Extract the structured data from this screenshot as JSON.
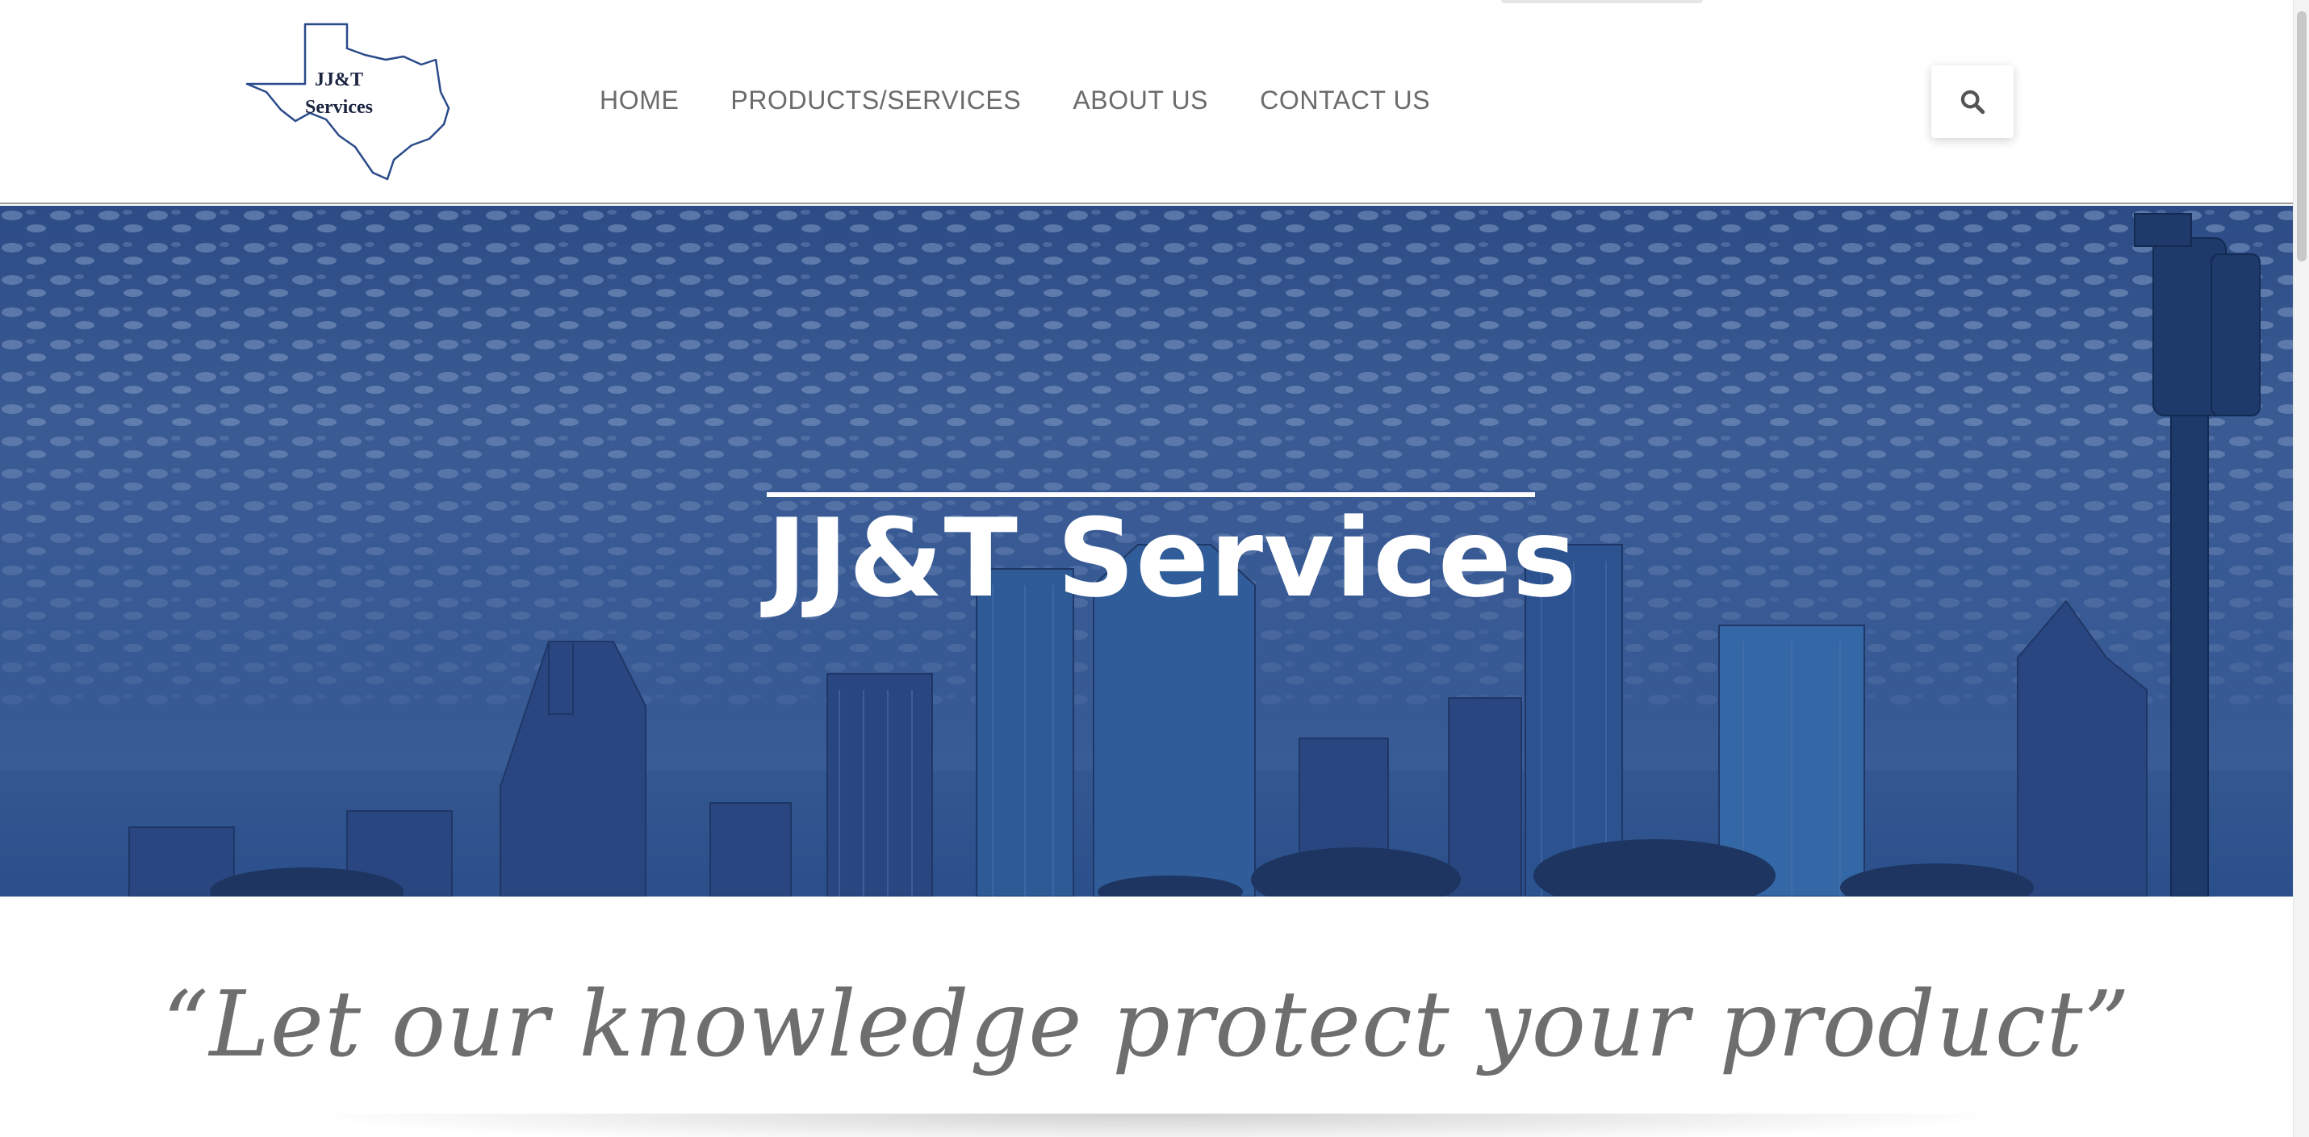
{
  "header": {
    "logo": {
      "line1": "JJ&T",
      "line2": "Services"
    },
    "nav": [
      {
        "label": "HOME"
      },
      {
        "label": "PRODUCTS/SERVICES"
      },
      {
        "label": "ABOUT US"
      },
      {
        "label": "CONTACT US"
      }
    ],
    "search_icon": "search-icon"
  },
  "hero": {
    "title": "JJ&T Services"
  },
  "tagline": {
    "text": "“Let our knowledge protect your product”"
  },
  "colors": {
    "nav_text": "#6b6b6b",
    "hero_overlay": "#2d4c86",
    "hero_text": "#ffffff",
    "tagline_text": "#6e6e6e",
    "logo_outline": "#2a4a8a"
  }
}
